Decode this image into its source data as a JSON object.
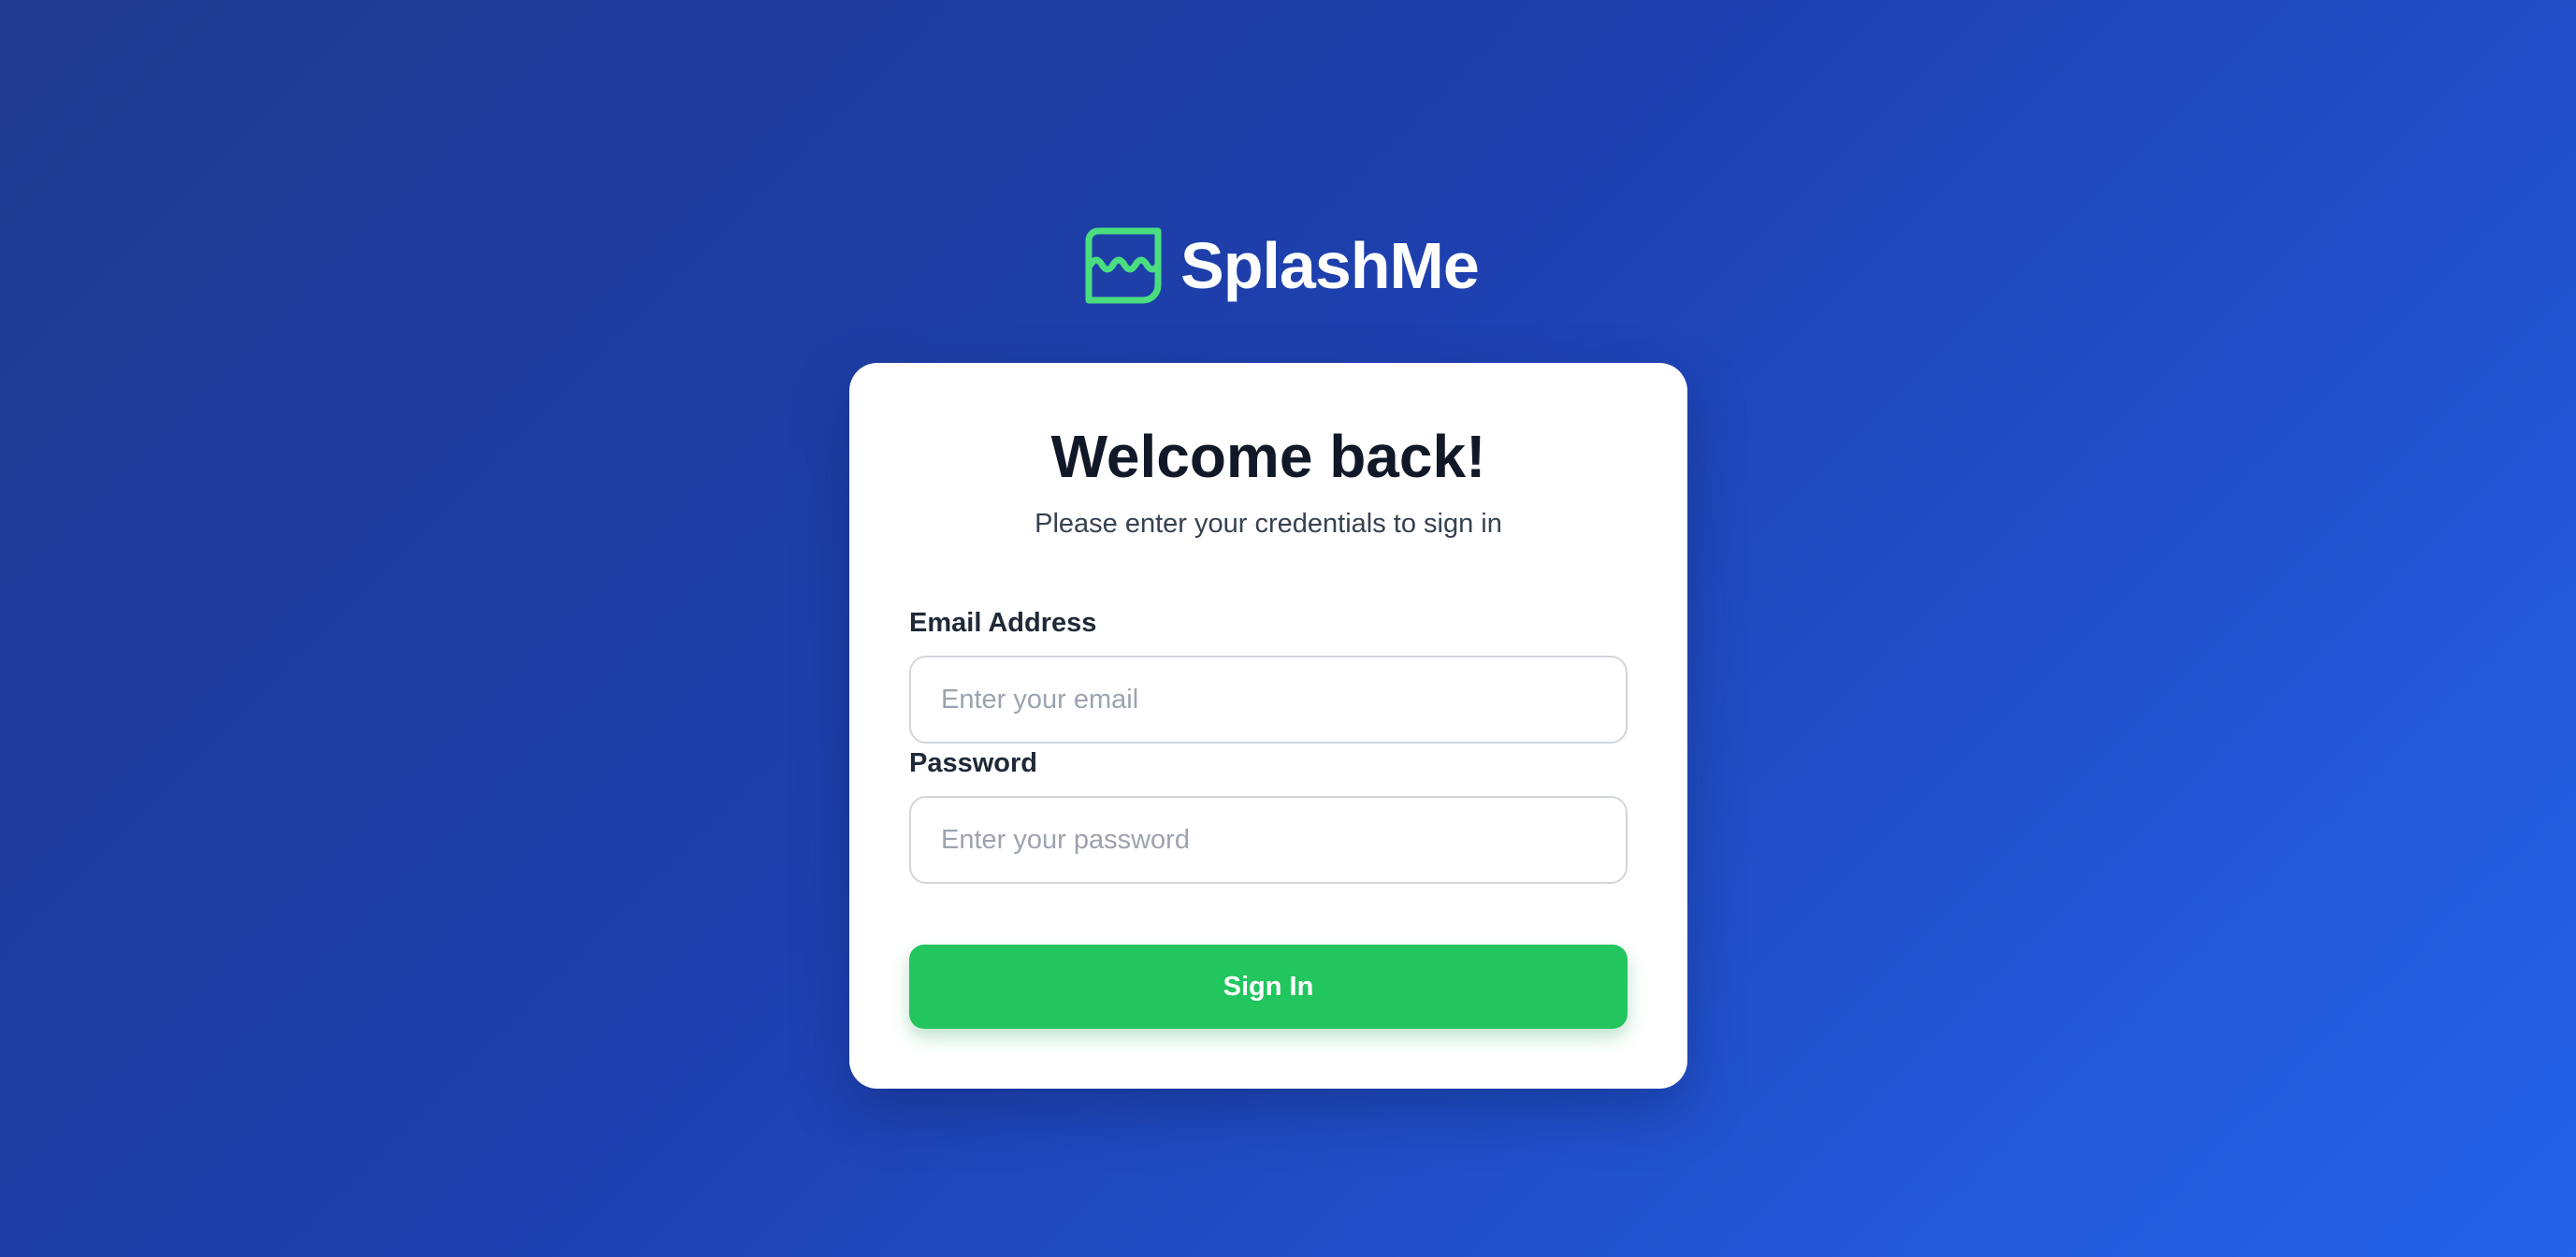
{
  "brand": {
    "name": "SplashMe",
    "logo_icon": "splash-wave-icon",
    "accent_color": "#22c55e"
  },
  "card": {
    "title": "Welcome back!",
    "subtitle": "Please enter your credentials to sign in"
  },
  "form": {
    "email": {
      "label": "Email Address",
      "placeholder": "Enter your email",
      "value": ""
    },
    "password": {
      "label": "Password",
      "placeholder": "Enter your password",
      "value": ""
    },
    "submit_label": "Sign In"
  },
  "colors": {
    "background_start": "#1f3a8e",
    "background_end": "#2563eb",
    "card": "#ffffff",
    "button": "#22c55e"
  }
}
